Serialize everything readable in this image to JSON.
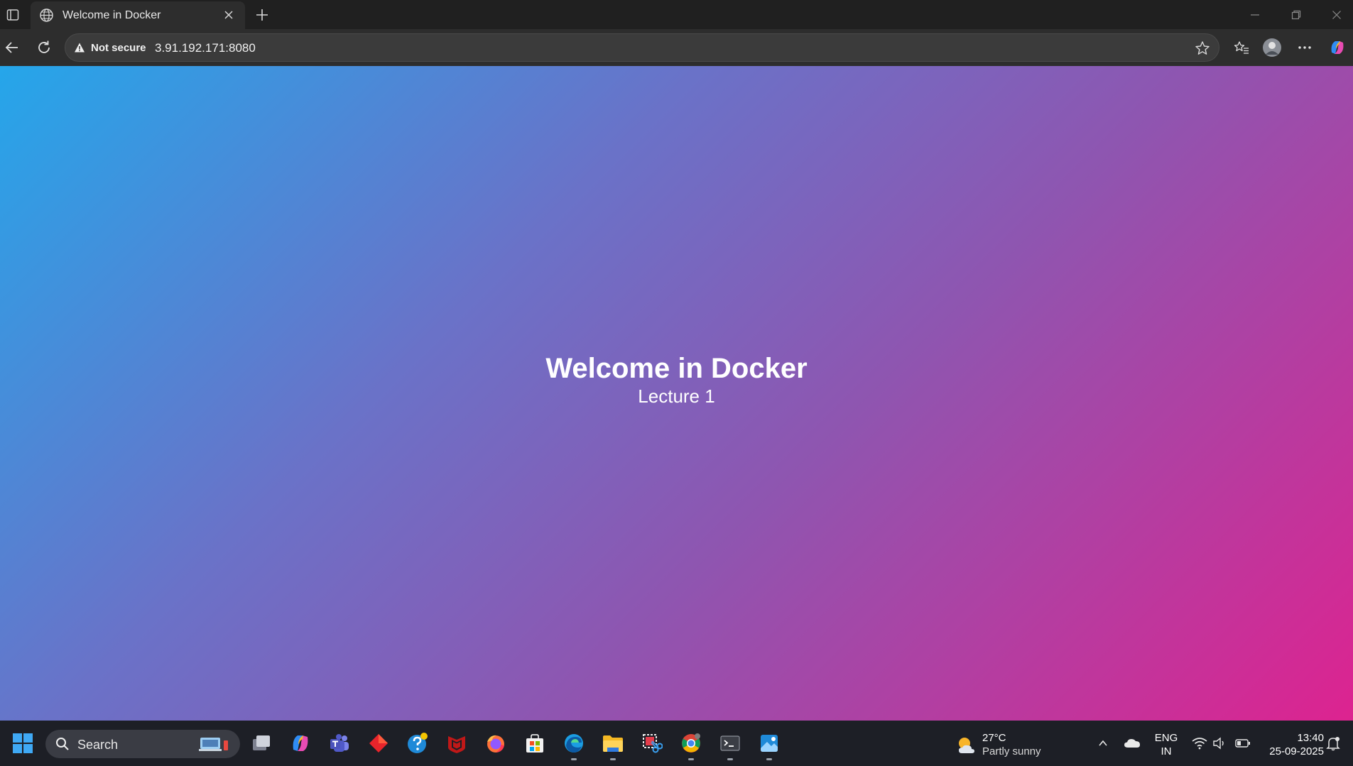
{
  "browser": {
    "tab": {
      "title": "Welcome in Docker"
    },
    "address_bar": {
      "security_label": "Not secure",
      "url": "3.91.192.171:8080"
    }
  },
  "page": {
    "heading": "Welcome in Docker",
    "subheading": "Lecture 1",
    "gradient_colors": [
      "#25a6ea",
      "#6a72c8",
      "#8f55b0",
      "#dd2390"
    ]
  },
  "taskbar": {
    "search_label": "Search",
    "pinned_apps": [
      "task-view",
      "copilot",
      "teams",
      "app-red-diamond",
      "help",
      "mcafee",
      "firefox",
      "microsoft-store",
      "edge",
      "file-explorer",
      "snipping-tool",
      "chrome",
      "terminal",
      "photos"
    ],
    "weather": {
      "temp": "27°C",
      "condition": "Partly sunny"
    },
    "language": {
      "line1": "ENG",
      "line2": "IN"
    },
    "clock": {
      "time": "13:40",
      "date": "25-09-2025"
    }
  }
}
